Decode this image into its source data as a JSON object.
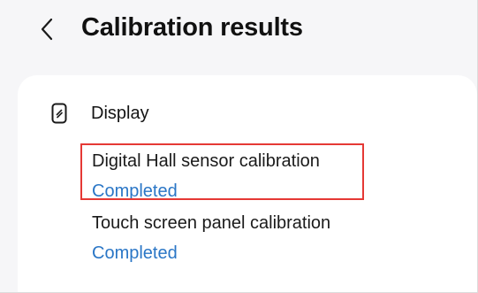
{
  "header": {
    "title": "Calibration results",
    "back_icon": "chevron-left-icon"
  },
  "section": {
    "title": "Display",
    "icon": "phone-outline-icon"
  },
  "items": [
    {
      "label": "Digital Hall sensor calibration",
      "status": "Completed",
      "highlighted": true
    },
    {
      "label": "Touch screen panel calibration",
      "status": "Completed",
      "highlighted": false
    }
  ],
  "colors": {
    "background": "#f6f6f8",
    "card": "#ffffff",
    "status_link": "#2a76c6",
    "highlight_border": "#e53935"
  }
}
